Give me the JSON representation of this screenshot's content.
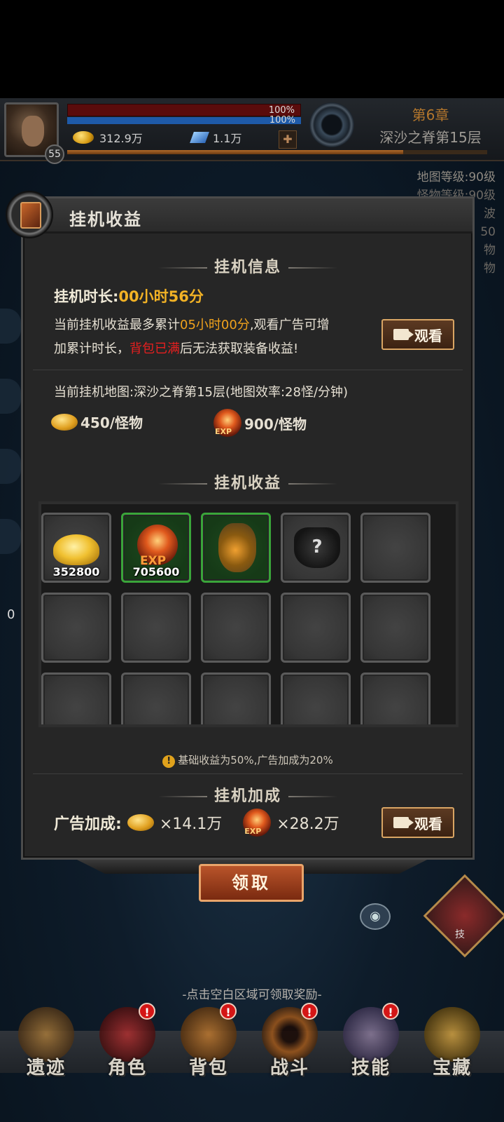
{
  "hud": {
    "level": "55",
    "hp_pct": "100%",
    "mp_pct": "100%",
    "gold": "312.9万",
    "gems": "1.1万",
    "chapter": "第6章",
    "floor": "深沙之脊第15层"
  },
  "map_info": {
    "line1": "地图等级:90级",
    "line2": "怪物等级:90级",
    "line3": "波",
    "line4": "50",
    "line5": "物",
    "line6": "物"
  },
  "panel": {
    "title": "挂机收益",
    "section_info": "挂机信息",
    "idle_label": "挂机时长:",
    "idle_time": "00小时56分",
    "desc_part1": "当前挂机收益最多累计",
    "desc_max_time": "05小时00分",
    "desc_part2": ",观看广告可增",
    "desc_part3": "加累计时长，",
    "desc_bag_full": "背包已满",
    "desc_part4": "后无法获取装备收益!",
    "watch_label": "观看",
    "map_line": "当前挂机地图:深沙之脊第15层(地图效率:28怪/分钟)",
    "gold_rate": "450/怪物",
    "exp_rate": "900/怪物",
    "exp_text": "EXP",
    "section_rewards": "挂机收益",
    "note": "基础收益为50%,广告加成为20%",
    "note_mark": "!",
    "section_bonus": "挂机加成",
    "bonus_label": "广告加成:",
    "bonus_gold": "×14.1万",
    "bonus_exp": "×28.2万",
    "claim_label": "领取"
  },
  "rewards": {
    "slots": [
      {
        "item": "gold",
        "count": "352800"
      },
      {
        "item": "exp",
        "count": "705600"
      },
      {
        "item": "bag",
        "count": ""
      },
      {
        "item": "unknown-armor",
        "count": ""
      }
    ],
    "unknown_mark": "?"
  },
  "hint": "-点击空白区域可领取奖励-",
  "nav": {
    "items": [
      {
        "label": "遗迹"
      },
      {
        "label": "角色"
      },
      {
        "label": "背包"
      },
      {
        "label": "战斗"
      },
      {
        "label": "技能"
      },
      {
        "label": "宝藏"
      }
    ],
    "alert": "!"
  },
  "skill_label": "技",
  "side_number": "0",
  "colors": {
    "accent_orange": "#f2b225",
    "warn_red": "#e81f1f",
    "slot_green": "#3aa53a",
    "button_border": "#d9a564"
  }
}
